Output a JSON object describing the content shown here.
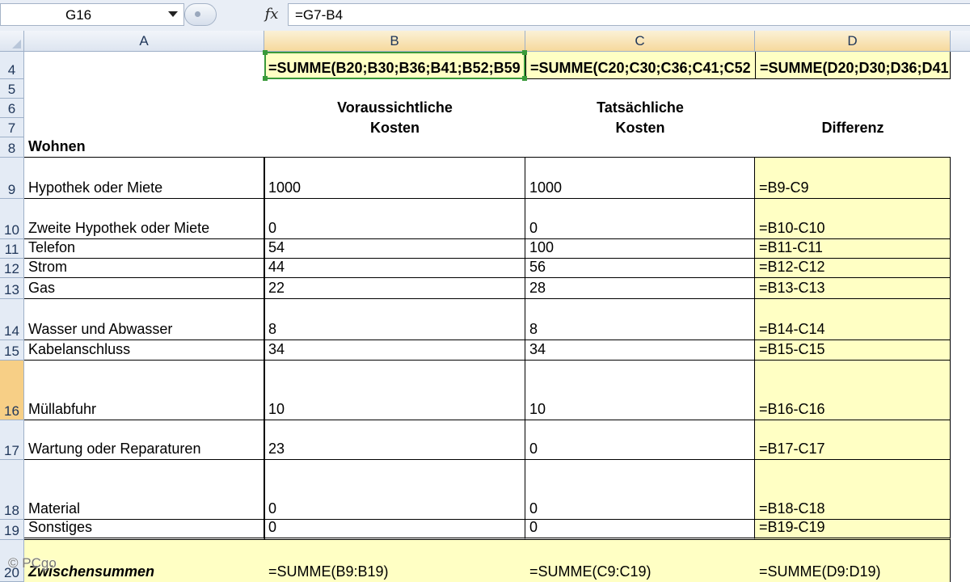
{
  "formula_bar": {
    "name_box": "G16",
    "fx_label": "fx",
    "formula": "=G7-B4"
  },
  "columns": [
    "A",
    "B",
    "C",
    "D"
  ],
  "row4": {
    "row": "4",
    "b": "=SUMME(B20;B30;B36;B41;B52;B59",
    "c": "=SUMME(C20;C30;C36;C41;C52",
    "d": "=SUMME(D20;D30;D36;D41"
  },
  "row_labels": [
    "5",
    "6",
    "7",
    "8"
  ],
  "headers": {
    "b_line1": "Voraussichtliche",
    "b_line2": "Kosten",
    "c_line1": "Tatsächliche",
    "c_line2": "Kosten",
    "d": "Differenz"
  },
  "section": "Wohnen",
  "rows": [
    {
      "row": "9",
      "label": "Hypothek oder Miete",
      "b": "1000",
      "c": "1000",
      "d": "=B9-C9"
    },
    {
      "row": "10",
      "label": "Zweite Hypothek oder Miete",
      "b": "0",
      "c": "0",
      "d": "=B10-C10"
    },
    {
      "row": "11",
      "label": "Telefon",
      "b": "54",
      "c": "100",
      "d": "=B11-C11"
    },
    {
      "row": "12",
      "label": "Strom",
      "b": "44",
      "c": "56",
      "d": "=B12-C12"
    },
    {
      "row": "13",
      "label": "Gas",
      "b": "22",
      "c": "28",
      "d": "=B13-C13"
    },
    {
      "row": "14",
      "label": "Wasser und Abwasser",
      "b": "8",
      "c": "8",
      "d": "=B14-C14"
    },
    {
      "row": "15",
      "label": "Kabelanschluss",
      "b": "34",
      "c": "34",
      "d": "=B15-C15"
    },
    {
      "row": "16",
      "label": "Müllabfuhr",
      "b": "10",
      "c": "10",
      "d": "=B16-C16"
    },
    {
      "row": "17",
      "label": "Wartung oder Reparaturen",
      "b": "23",
      "c": "0",
      "d": "=B17-C17"
    },
    {
      "row": "18",
      "label": "Material",
      "b": "0",
      "c": "0",
      "d": "=B18-C18"
    },
    {
      "row": "19",
      "label": "Sonstiges",
      "b": "0",
      "c": "0",
      "d": "=B19-C19"
    }
  ],
  "subtotal": {
    "row": "20",
    "label": "Zwischensummen",
    "b": "=SUMME(B9:B19)",
    "c": "=SUMME(C9:C19)",
    "d": "=SUMME(D9:D19)"
  },
  "watermark": "© PCgo"
}
